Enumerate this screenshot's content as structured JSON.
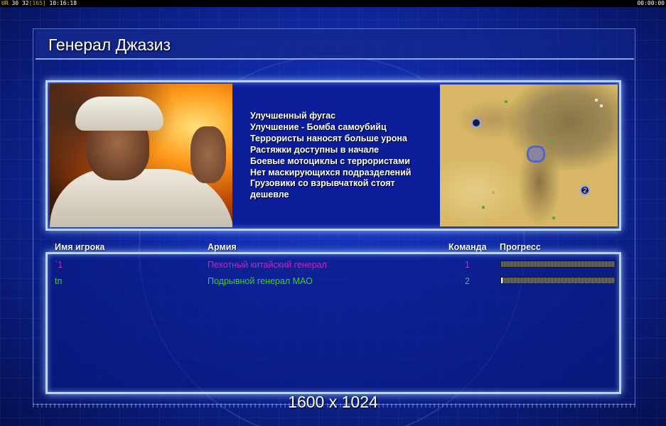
{
  "status_bar": {
    "ur_label": "UR",
    "fps": "30",
    "frames": "32",
    "frame_count": "[165]",
    "clock": "10:16:18",
    "timer": "00:00:00"
  },
  "general": {
    "title": "Генерал Джазиз",
    "features": [
      "Улучшенный фугас",
      "Улучшение - Бомба самоубийц",
      "Террористы наносят больше урона",
      "Растяжки доступны в начале",
      "Боевые мотоциклы с террористами",
      "Нет маскирующихся подразделений",
      "Грузовики со взрывчаткой стоят",
      " дешевле"
    ]
  },
  "minimap": {
    "start_positions": [
      "1",
      "2"
    ],
    "colors": {
      "sand": "#d8b866",
      "marker_border": "#8aa0ff",
      "water": "#5566c8",
      "units": "#4caf3a"
    }
  },
  "table": {
    "headers": {
      "player_name": "Имя игрока",
      "army": "Армия",
      "team": "Команда",
      "progress": "Прогресс"
    },
    "players": [
      {
        "name": "`1",
        "army": "Пехотный китайский генерал",
        "team": "1",
        "progress": 0.0,
        "color": "#c028c0"
      },
      {
        "name": "tn",
        "army": "Подрывной генерал МАО",
        "team": "2",
        "progress": 0.01,
        "color": "#40d020"
      }
    ]
  },
  "footer": {
    "resolution": "1600 x 1024"
  },
  "colors": {
    "panel_border": "#b8d4ff",
    "background": "#1430b4",
    "text": "#ffffff"
  }
}
